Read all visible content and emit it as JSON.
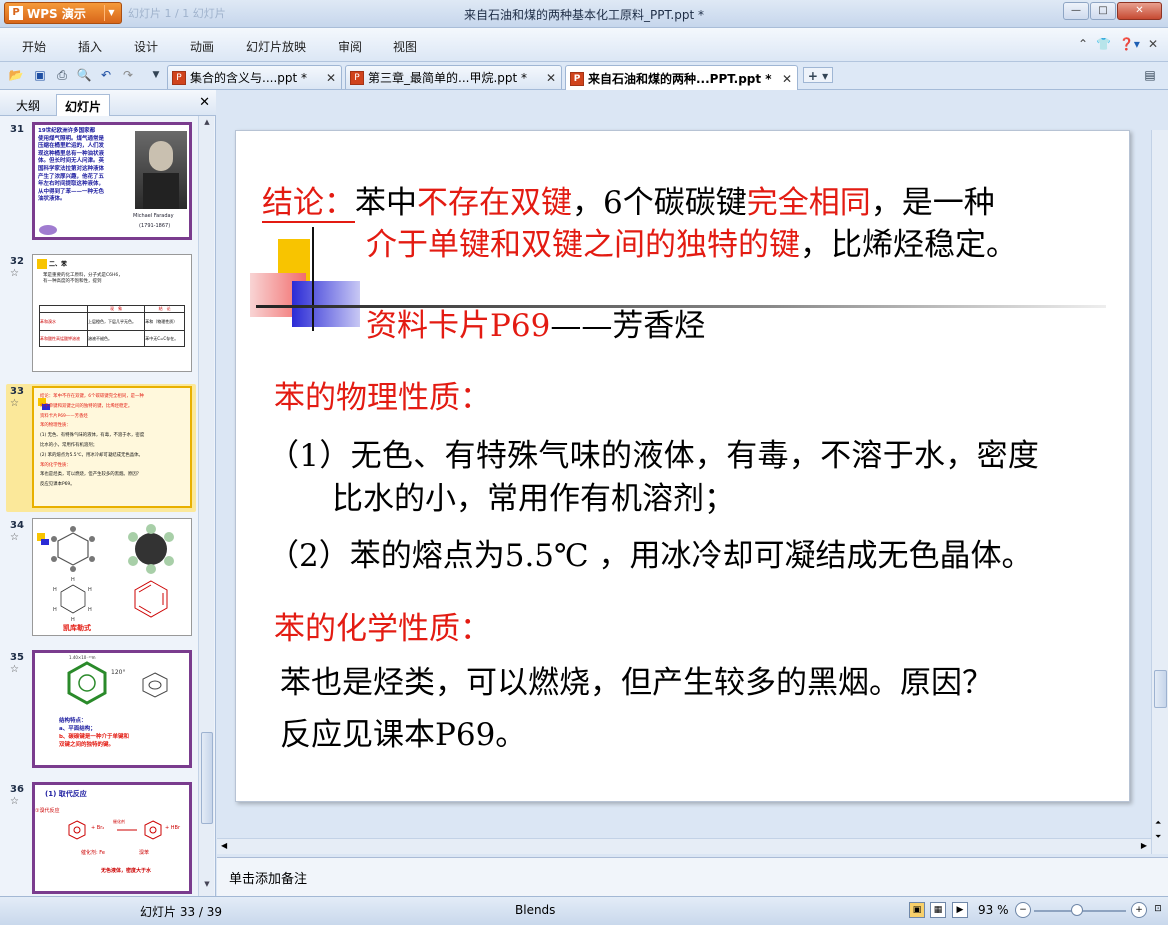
{
  "app": {
    "button_label": "WPS 演示",
    "logo_char": "P",
    "window_title": "来自石油和煤的两种基本化工原料_PPT.ppt *",
    "faded_text": "幻灯片 1 / 1 幻灯片"
  },
  "menu": [
    "开始",
    "插入",
    "设计",
    "动画",
    "幻灯片放映",
    "审阅",
    "视图"
  ],
  "doc_tabs": [
    {
      "label": "集合的含义与....ppt *",
      "active": false
    },
    {
      "label": "第三章_最简单的...甲烷.ppt *",
      "active": false
    },
    {
      "label": "来自石油和煤的两种...PPT.ppt *",
      "active": true
    }
  ],
  "side_panel": {
    "tabs": [
      "大纲",
      "幻灯片"
    ],
    "active_tab": "幻灯片",
    "thumbnails": [
      {
        "number": "31",
        "has_star": true,
        "texts": [
          "19世纪欧洲许多国家都",
          "使用煤气照明。煤气通常是",
          "压缩在桶里贮运的，人们发",
          "现这种桶里总有一种油状液",
          "体。但长时间无人问津。英",
          "国科学家法拉第对这种液体",
          "产生了浓厚兴趣，他花了五",
          "年左右时间提取这种液体，",
          "从中得到了苯——一种无色",
          "油状液体。"
        ],
        "portrait_caption": "Michael Faraday",
        "portrait_years": "(1791-1867)"
      },
      {
        "number": "32",
        "has_star": true,
        "title": "二、苯",
        "texts": [
          "苯是重要的化工原料，分子式是C6H6，",
          "有一种高度的不饱和性，提到"
        ],
        "table_headers": [
          "现　象",
          "结　论"
        ],
        "table_rows": [
          [
            "苯和溴水",
            "上层橙色，下层几乎无色。",
            "苯和（物理性质）"
          ],
          [
            "苯和酸性高锰酸钾溶液",
            "溶液不褪色。",
            "苯中无C=C存在。"
          ]
        ]
      },
      {
        "number": "33",
        "has_star": true,
        "selected": true,
        "texts": [
          "结论：苯中不存在双键，6个碳碳键完全相同，是一种",
          "介于单键和双键之间的独特的键，比烯烃稳定。",
          "资料卡片P69——芳香烃",
          "苯的物理性质：",
          "(1) 无色、有特殊气味的液体，有毒，不溶于水，密度",
          "比水的小，常用作有机溶剂；",
          "(2) 苯的熔点为5.5℃，用冰冷却可凝结成无色晶体。",
          "苯的化学性质：",
          "苯也是烃类，可以燃烧，但产生较多的黑烟。原因？",
          "反应见课本P69。"
        ]
      },
      {
        "number": "34",
        "has_star": true,
        "caption": "凯库勒式"
      },
      {
        "number": "35",
        "has_star": true,
        "bond_label": "1.40×10⁻¹⁰m",
        "angle_label": "120°",
        "texts": [
          "结构特点：",
          "a、平面结构；",
          "b、碳碳键是一种介于单键和",
          "双键之间的独特的键。"
        ]
      },
      {
        "number": "36",
        "has_star": true,
        "title": "(1) 取代反应",
        "texts": [
          "①溴代反应",
          "+ Br₂",
          "+ HBr",
          "催化剂: Fe",
          "溴苯",
          "无色液体，密度大于水"
        ],
        "arrow_label": "催化剂"
      }
    ]
  },
  "slide": {
    "line1": {
      "label": "结论：",
      "p1": "苯中",
      "p2": "不存在双键",
      "p3": "，6个碳碳键",
      "p4": "完全相同",
      "p5": "，是一种"
    },
    "line2": {
      "p1": "介于单键和双键之间的独特的键",
      "p2": "，比烯烃稳定。"
    },
    "card": {
      "p1": "资料卡片P69",
      "p2": "——芳香烃"
    },
    "physical_title": "苯的物理性质：",
    "physical": [
      "（1）无色、有特殊气味的液体，有毒，不溶于水，密度",
      "比水的小，常用作有机溶剂；",
      "（2）苯的熔点为5.5℃ ，用冰冷却可凝结成无色晶体。"
    ],
    "chemical_title": "苯的化学性质：",
    "chemical": [
      "苯也是烃类，可以燃烧，但产生较多的黑烟。原因？",
      "反应见课本P69。"
    ]
  },
  "notes_placeholder": "单击添加备注",
  "status": {
    "slide_counter": "幻灯片 33 / 39",
    "theme": "Blends",
    "zoom": "93 %"
  },
  "colors": {
    "accent_red": "#e31b12",
    "deco_yellow": "#f8c400",
    "deco_blue": "#2b2bd6",
    "deco_pink": "#f26c6c",
    "selection": "#e8b000"
  }
}
